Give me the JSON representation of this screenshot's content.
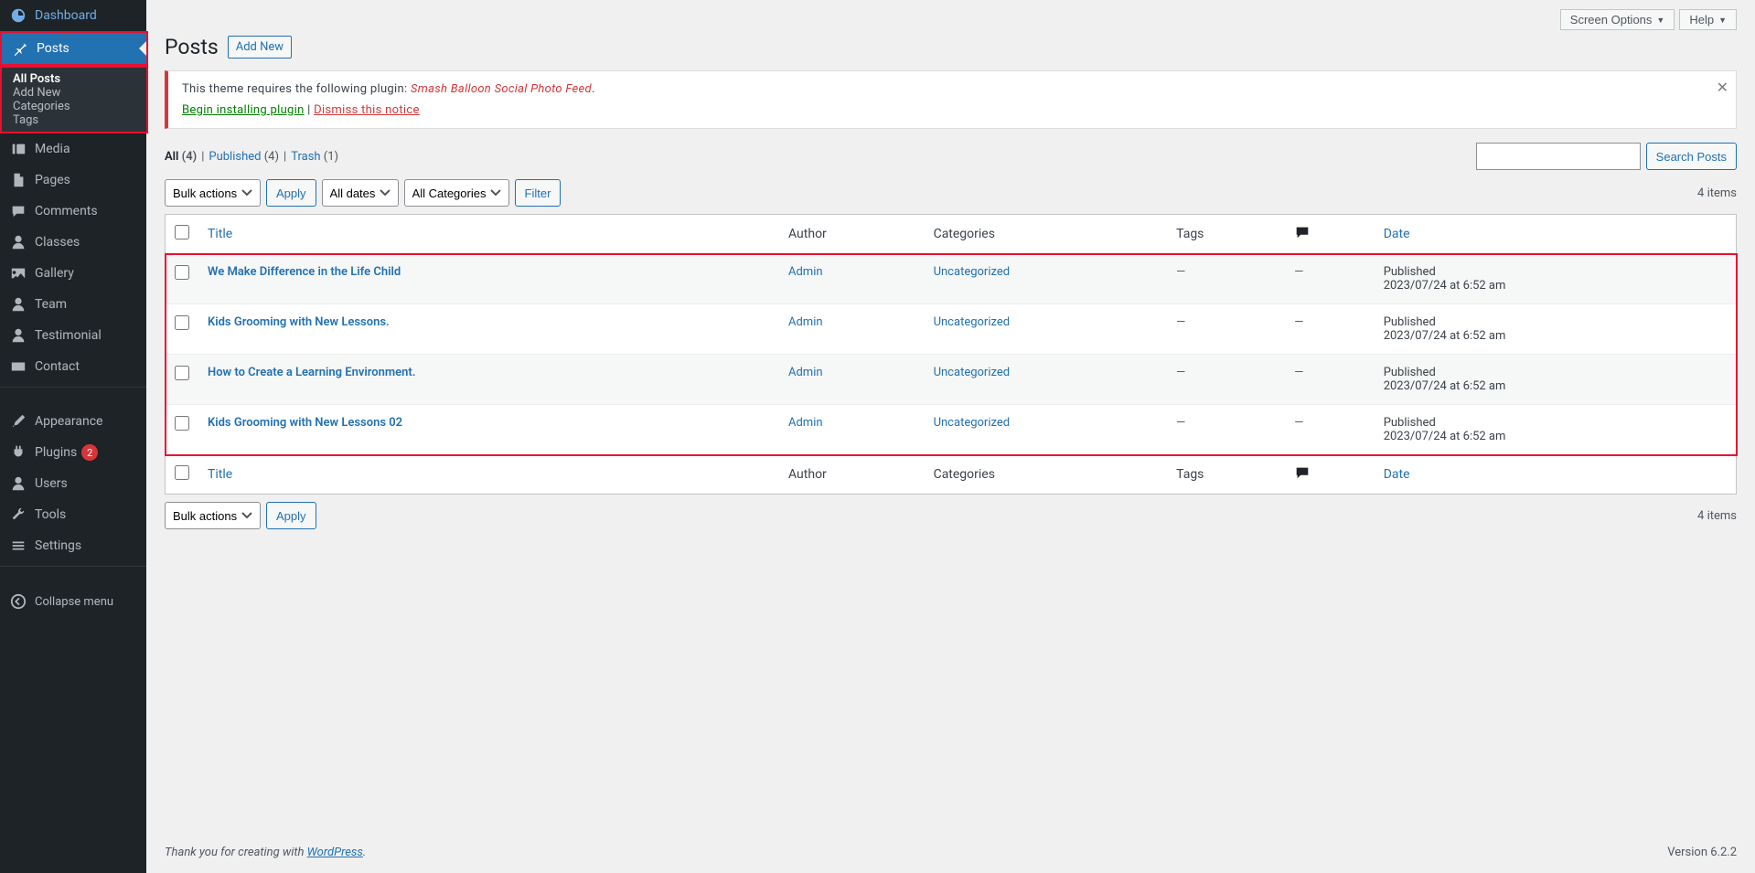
{
  "topButtons": {
    "screenOptions": "Screen Options",
    "help": "Help"
  },
  "sidebar": {
    "dashboard": "Dashboard",
    "posts": "Posts",
    "submenu": {
      "allPosts": "All Posts",
      "addNew": "Add New",
      "categories": "Categories",
      "tags": "Tags"
    },
    "media": "Media",
    "pages": "Pages",
    "comments": "Comments",
    "classes": "Classes",
    "gallery": "Gallery",
    "team": "Team",
    "testimonial": "Testimonial",
    "contact": "Contact",
    "appearance": "Appearance",
    "plugins": "Plugins",
    "pluginsBadge": "2",
    "users": "Users",
    "tools": "Tools",
    "settings": "Settings",
    "collapse": "Collapse menu"
  },
  "heading": {
    "title": "Posts",
    "addNew": "Add New"
  },
  "notice": {
    "text1": "This theme requires the following plugin: ",
    "pluginName": "Smash Balloon Social Photo Feed",
    "installLink": "Begin installing plugin",
    "sep": " | ",
    "dismissLink": "Dismiss this notice"
  },
  "filters": {
    "all": "All",
    "allCount": "(4)",
    "published": "Published",
    "publishedCount": "(4)",
    "trash": "Trash",
    "trashCount": "(1)"
  },
  "search": {
    "button": "Search Posts"
  },
  "bulk": {
    "label": "Bulk actions",
    "apply": "Apply",
    "allDates": "All dates",
    "allCategories": "All Categories",
    "filter": "Filter",
    "items": "4 items"
  },
  "columns": {
    "title": "Title",
    "author": "Author",
    "categories": "Categories",
    "tags": "Tags",
    "date": "Date"
  },
  "posts": [
    {
      "title": "We Make Difference in the Life Child",
      "author": "Admin",
      "category": "Uncategorized",
      "tags": "—",
      "comments": "—",
      "status": "Published",
      "date": "2023/07/24 at 6:52 am"
    },
    {
      "title": "Kids Grooming with New Lessons.",
      "author": "Admin",
      "category": "Uncategorized",
      "tags": "—",
      "comments": "—",
      "status": "Published",
      "date": "2023/07/24 at 6:52 am"
    },
    {
      "title": "How to Create a Learning Environment.",
      "author": "Admin",
      "category": "Uncategorized",
      "tags": "—",
      "comments": "—",
      "status": "Published",
      "date": "2023/07/24 at 6:52 am"
    },
    {
      "title": "Kids Grooming with New Lessons 02",
      "author": "Admin",
      "category": "Uncategorized",
      "tags": "—",
      "comments": "—",
      "status": "Published",
      "date": "2023/07/24 at 6:52 am"
    }
  ],
  "footer": {
    "thanks": "Thank you for creating with ",
    "wp": "WordPress",
    "version": "Version 6.2.2"
  }
}
